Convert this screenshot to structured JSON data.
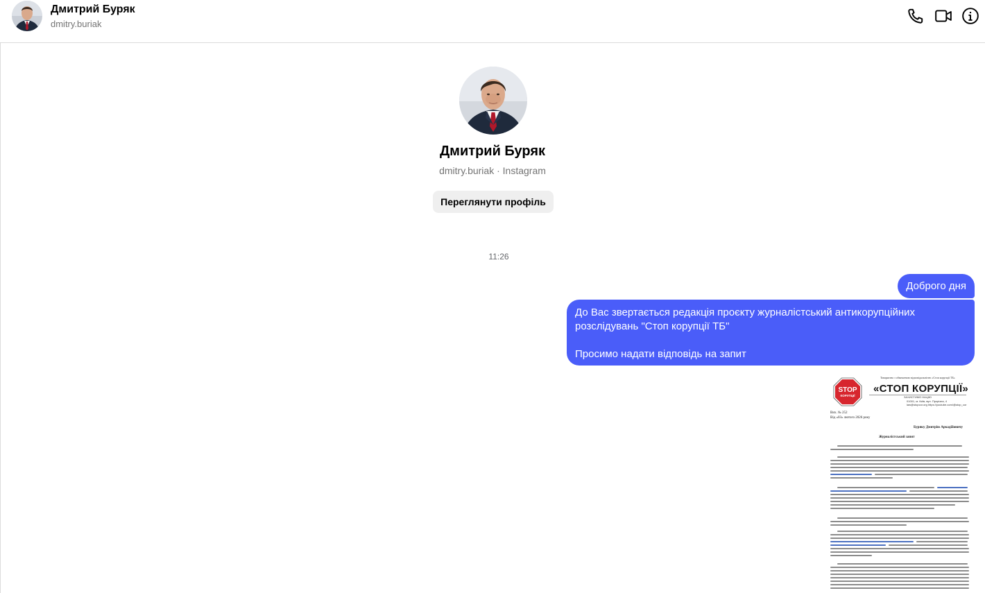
{
  "header": {
    "name": "Дмитрий Буряк",
    "username": "dmitry.buriak",
    "actions": [
      {
        "name": "phone-call-icon"
      },
      {
        "name": "video-call-icon"
      },
      {
        "name": "conversation-info-icon"
      }
    ]
  },
  "profile": {
    "name": "Дмитрий Буряк",
    "subtitle": "dmitry.buriak · Instagram",
    "view_profile_label": "Переглянути профіль"
  },
  "thread": {
    "timestamp": "11:26",
    "messages": [
      {
        "sender": "me",
        "text": "Доброго дня"
      },
      {
        "sender": "me",
        "lines": [
          "До Вас звертається редакція проєкту журналістський антикорупційних розслідувань \"Стоп корупції ТБ\"",
          "Просимо надати відповідь на запит"
        ]
      }
    ]
  },
  "attachment": {
    "type": "document-image",
    "header_small": "Товариство з обмеженою відповідальністю «Стоп корупції ТБ»",
    "stop_sign_top": "STOP",
    "stop_sign_bottom": "КОРУПЦІЇ",
    "brand": "«СТОП КОРУПЦІЇ»",
    "brand_sub": "ЗАХИСТИМО НАЦІЮ",
    "address_line1": "01001, м. Київ, вул. Прорізна, 4",
    "address_line2": "law@stopcor.org  https://youtube.com/@stop_cor",
    "ref_number": "Вих. № 252",
    "ref_date": "Від «03» лютого 2026 року",
    "addressee": "Буряку Дмитрію Аркадійовичу",
    "title": "Журналістський запит"
  },
  "colors": {
    "bubble": "#4a5df9",
    "button_bg": "#efefef",
    "border": "#dbdbdb",
    "muted_text": "#737373",
    "stop_red": "#d7262e"
  }
}
